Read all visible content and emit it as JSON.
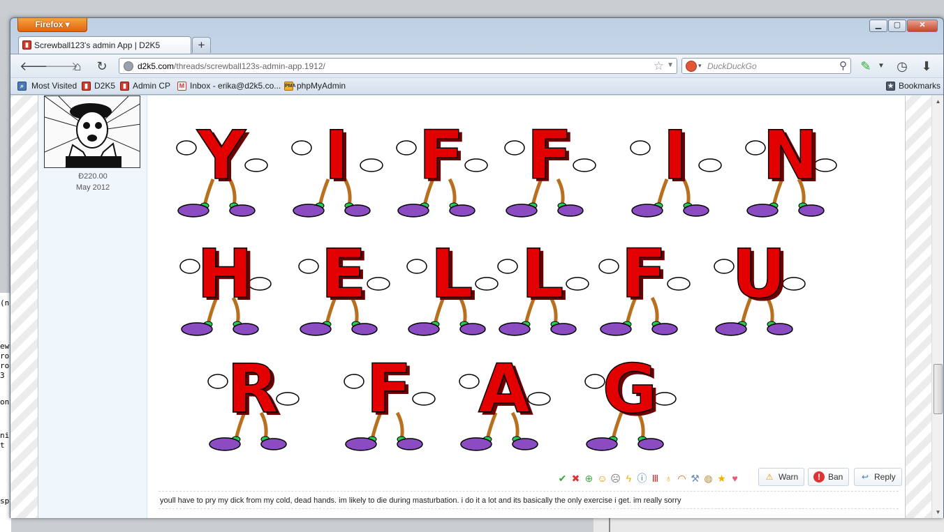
{
  "browser": {
    "app_button": "Firefox ▾",
    "tab_title": "Screwball123's admin App | D2K5",
    "url_host": "d2k5.com",
    "url_path": "/threads/screwball123s-admin-app.1912/",
    "search_placeholder": "DuckDuckGo",
    "window_controls": [
      "minimize",
      "maximize",
      "close"
    ]
  },
  "bookmarks": {
    "items": [
      "Most Visited",
      "D2K5",
      "Admin CP",
      "Inbox - erika@d2k5.co...",
      "phpMyAdmin"
    ],
    "right": "Bookmarks"
  },
  "post": {
    "user_balance": "Đ220.00",
    "user_join_date": "May 2012",
    "image_letter_rows": [
      [
        "Y",
        "I",
        "F",
        "F",
        "I",
        "N"
      ],
      [
        "H",
        "E",
        "L",
        "L",
        "F",
        "U"
      ],
      [
        "R",
        "F",
        "A",
        "G"
      ]
    ],
    "rating_icons": [
      "agree-icon",
      "disagree-icon",
      "plus-icon",
      "smile-icon",
      "dumb-icon",
      "lightning-icon",
      "info-icon",
      "bars-icon",
      "bulb-icon",
      "rainbow-icon",
      "wrench-icon",
      "palette-icon",
      "star-icon",
      "heart-icon"
    ],
    "actions": {
      "warn": "Warn",
      "ban": "Ban",
      "reply": "Reply"
    },
    "signature": "youll have to pry my dick from my cold, dead hands. im likely to die during masturbation. i do it a lot and its basically the only exercise i get. im really sorry"
  },
  "colors": {
    "letter_red": "#e30000",
    "shoe_purple": "#8a4cc0",
    "sock_green": "#22cc55",
    "user_column_bg": "#f0f7fc",
    "firefox_orange": "#e8761c"
  }
}
